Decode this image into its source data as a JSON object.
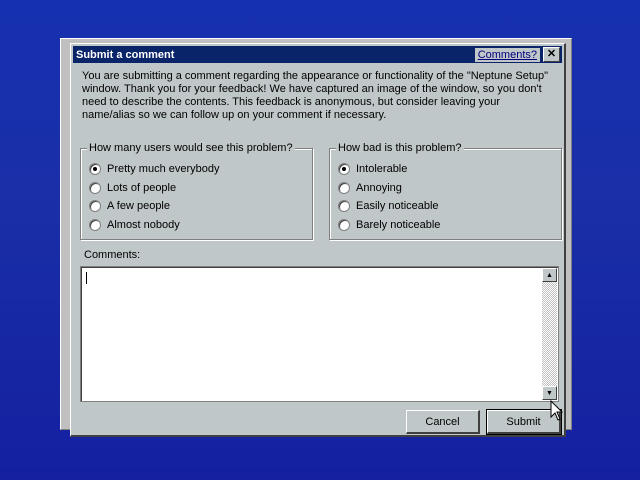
{
  "dialog": {
    "title": "Submit a comment",
    "help_link": "Comments?",
    "close_label": "✕",
    "intro": "You are submitting a comment regarding the appearance or functionality of the \"Neptune Setup\" window. Thank you for your feedback! We have captured an image of the window, so you don't need to describe the contents. This feedback is anonymous, but consider leaving your name/alias so we can follow up on your comment if necessary."
  },
  "users_group": {
    "label": "How many users would see this problem?",
    "options": [
      "Pretty much everybody",
      "Lots of people",
      "A few people",
      "Almost nobody"
    ],
    "selected": "Pretty much everybody"
  },
  "severity_group": {
    "label": "How bad is this problem?",
    "options": [
      "Intolerable",
      "Annoying",
      "Easily noticeable",
      "Barely noticeable"
    ],
    "selected": "Intolerable"
  },
  "comments": {
    "label": "Comments:",
    "value": ""
  },
  "buttons": {
    "cancel": "Cancel",
    "submit": "Submit"
  }
}
